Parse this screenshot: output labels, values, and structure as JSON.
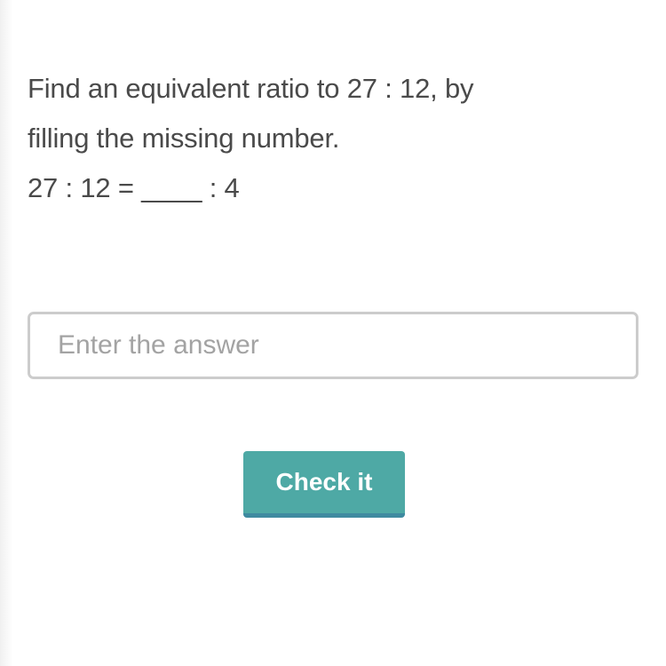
{
  "question": {
    "line1": "Find an equivalent ratio to 27 : 12, by",
    "line2": "filling the missing number.",
    "equation": "27 : 12 = ____ : 4"
  },
  "answer_input": {
    "value": "",
    "placeholder": "Enter the answer"
  },
  "check_button": {
    "label": "Check it"
  },
  "colors": {
    "accent": "#4ea9a5",
    "accent_shadow": "#3e8aa0",
    "text": "#4a4a4a",
    "placeholder": "#a3a3a3",
    "input_border": "#cccccc"
  }
}
